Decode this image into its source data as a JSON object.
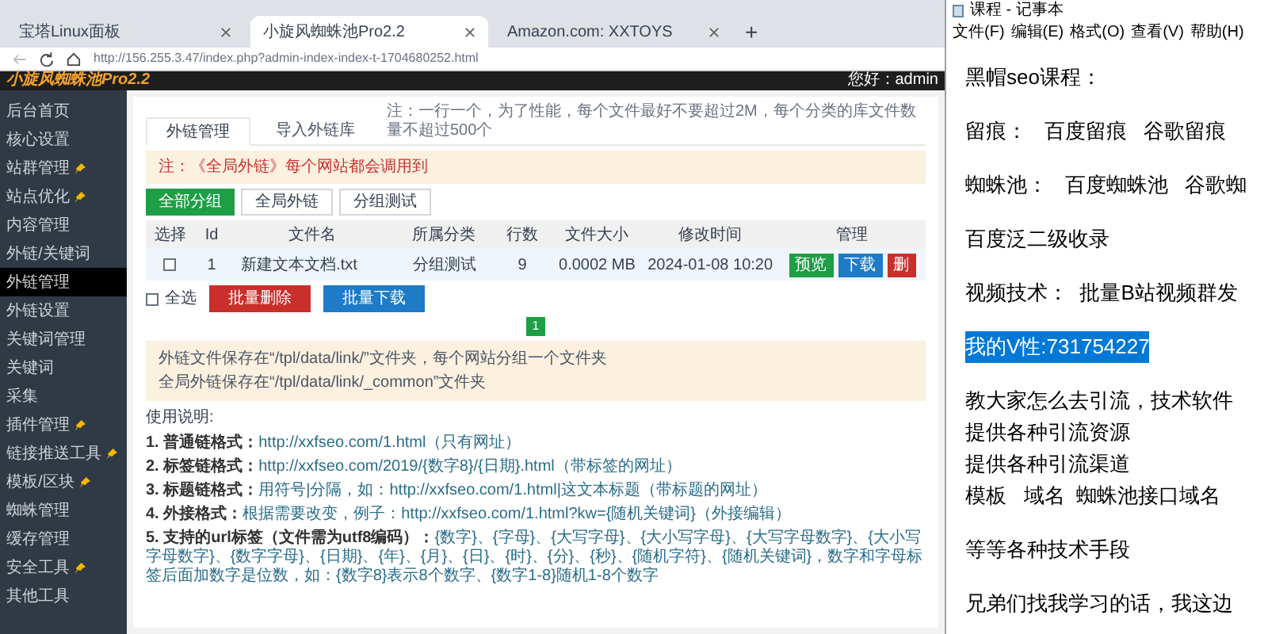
{
  "browser": {
    "tabs": [
      {
        "label": "宝塔Linux面板",
        "selected": false
      },
      {
        "label": "小旋风蜘蛛池Pro2.2",
        "selected": true
      },
      {
        "label": "Amazon.com: XXTOYS",
        "selected": false
      }
    ],
    "new_tab": "+",
    "url": "http://156.255.3.47/index.php?admin-index-index-t-1704680252.html"
  },
  "app": {
    "title": "小旋风蜘蛛池Pro2.2",
    "greeting": "您好：admin"
  },
  "sidebar": {
    "items": [
      {
        "label": "后台首页",
        "pinned": false,
        "selected": false
      },
      {
        "label": "核心设置",
        "pinned": false,
        "selected": false
      },
      {
        "label": "站群管理",
        "pinned": true,
        "selected": false
      },
      {
        "label": "站点优化",
        "pinned": true,
        "selected": false
      },
      {
        "label": "内容管理",
        "pinned": false,
        "selected": false
      },
      {
        "label": "外链/关键词",
        "pinned": false,
        "selected": false
      },
      {
        "label": "外链管理",
        "pinned": false,
        "selected": true
      },
      {
        "label": "外链设置",
        "pinned": false,
        "selected": false
      },
      {
        "label": "关键词管理",
        "pinned": false,
        "selected": false
      },
      {
        "label": "关键词",
        "pinned": false,
        "selected": false
      },
      {
        "label": "采集",
        "pinned": false,
        "selected": false
      },
      {
        "label": "插件管理",
        "pinned": true,
        "selected": false
      },
      {
        "label": "链接推送工具",
        "pinned": true,
        "selected": false
      },
      {
        "label": "模板/区块",
        "pinned": true,
        "selected": false
      },
      {
        "label": "蜘蛛管理",
        "pinned": false,
        "selected": false
      },
      {
        "label": "缓存管理",
        "pinned": false,
        "selected": false
      },
      {
        "label": "安全工具",
        "pinned": true,
        "selected": false
      },
      {
        "label": "其他工具",
        "pinned": false,
        "selected": false
      }
    ]
  },
  "content": {
    "tabs": [
      {
        "label": "外链管理",
        "selected": true
      },
      {
        "label": "导入外链库",
        "selected": false
      }
    ],
    "tab_note": "注：一行一个，为了性能，每个文件最好不要超过2M，每个分类的库文件数量不超过500个",
    "alert": "注：《全局外链》每个网站都会调用到",
    "groups": [
      {
        "label": "全部分组",
        "selected": true
      },
      {
        "label": "全局外链",
        "selected": false
      },
      {
        "label": "分组测试",
        "selected": false
      }
    ],
    "table": {
      "columns": [
        "选择",
        "Id",
        "文件名",
        "所属分类",
        "行数",
        "文件大小",
        "修改时间",
        "管理"
      ],
      "rows": [
        {
          "checked": false,
          "id": "1",
          "file": "新建文本文档.txt",
          "category": "分组测试",
          "lines": "9",
          "size": "0.0002 MB",
          "modified": "2024-01-08 10:20",
          "actions": [
            "预览",
            "下载",
            "删"
          ]
        }
      ]
    },
    "select_all": {
      "label": "全选",
      "checked": false
    },
    "batch_buttons": [
      "批量删除",
      "批量下载"
    ],
    "pages": [
      {
        "label": "1",
        "selected": true
      }
    ],
    "info": [
      "外链文件保存在“/tpl/data/link/”文件夹，每个网站分组一个文件夹",
      "全局外链保存在“/tpl/data/link/_common”文件夹"
    ],
    "help_title": "使用说明:",
    "help": [
      {
        "label": "1. 普通链格式：",
        "text": "http://xxfseo.com/1.html（只有网址）"
      },
      {
        "label": "2. 标签链格式：",
        "text": "http://xxfseo.com/2019/{数字8}/{日期}.html（带标签的网址）"
      },
      {
        "label": "3. 标题链格式：",
        "text": "用符号|分隔，如：http://xxfseo.com/1.html|这文本标题（带标题的网址）"
      },
      {
        "label": "4. 外接格式：",
        "text": "根据需要改变，例子：http://xxfseo.com/1.html?kw={随机关键词}（外接编辑）"
      },
      {
        "label": "5. 支持的url标签（文件需为utf8编码）：",
        "text": "{数字}、{字母}、{大写字母}、{大小写字母}、{大写字母数字}、{大小写字母数字}、{数字字母}、{日期}、{年}、{月}、{日}、{时}、{分}、{秒}、{随机字符}、{随机关键词}，数字和字母标签后面加数字是位数，如：{数字8}表示8个数字、{数字1-8}随机1-8个数字"
      }
    ]
  },
  "notepad": {
    "title": "课程 - 记事本",
    "menu": [
      "文件(F)",
      "编辑(E)",
      "格式(O)",
      "查看(V)",
      "帮助(H)"
    ],
    "paragraphs": [
      [
        {
          "text": "黑帽seo课程：",
          "selected": false
        }
      ],
      [
        {
          "text": "留痕：   百度留痕   谷歌留痕",
          "selected": false
        }
      ],
      [
        {
          "text": "蜘蛛池：   百度蜘蛛池   谷歌蜘",
          "selected": false
        }
      ],
      [
        {
          "text": "百度泛二级收录",
          "selected": false
        }
      ],
      [
        {
          "text": "视频技术：  批量B站视频群发",
          "selected": false
        }
      ],
      [
        {
          "text": "我的V性:731754227",
          "selected": true
        }
      ],
      [
        {
          "text": "教大家怎么去引流，技术软件",
          "selected": false
        },
        {
          "text": "提供各种引流资源",
          "selected": false
        },
        {
          "text": "提供各种引流渠道",
          "selected": false
        },
        {
          "text": "模板   域名  蜘蛛池接口域名",
          "selected": false
        }
      ],
      [
        {
          "text": "等等各种技术手段",
          "selected": false
        }
      ],
      [
        {
          "text": "兄弟们找我学习的话，我这边",
          "selected": false
        }
      ]
    ]
  }
}
